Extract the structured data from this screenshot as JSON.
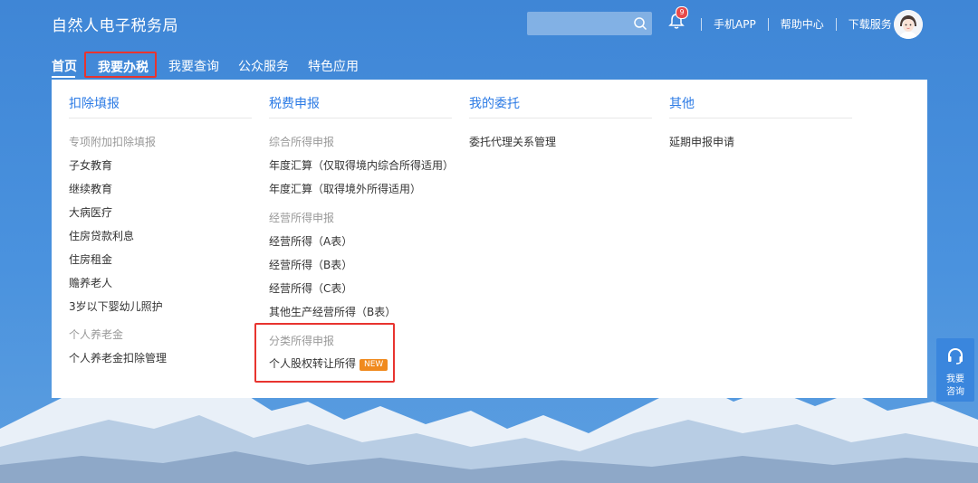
{
  "header": {
    "site_title": "自然人电子税务局",
    "search_placeholder": "",
    "notification_count": "9",
    "links": [
      "手机APP",
      "帮助中心",
      "下载服务"
    ]
  },
  "nav": {
    "home": "首页",
    "tax": "我要办税",
    "query": "我要查询",
    "public": "公众服务",
    "special": "特色应用"
  },
  "menu": {
    "col1": {
      "title": "扣除填报",
      "sub1": "专项附加扣除填报",
      "items1": [
        "子女教育",
        "继续教育",
        "大病医疗",
        "住房贷款利息",
        "住房租金",
        "赡养老人",
        "3岁以下婴幼儿照护"
      ],
      "sub2": "个人养老金",
      "items2": [
        "个人养老金扣除管理"
      ]
    },
    "col2": {
      "title": "税费申报",
      "sub1": "综合所得申报",
      "items1": [
        "年度汇算（仅取得境内综合所得适用）",
        "年度汇算（取得境外所得适用）"
      ],
      "sub2": "经营所得申报",
      "items2": [
        "经营所得（A表）",
        "经营所得（B表）",
        "经营所得（C表）",
        "其他生产经营所得（B表）"
      ],
      "sub3": "分类所得申报",
      "items3": [
        "个人股权转让所得"
      ],
      "new_label": "NEW"
    },
    "col3": {
      "title": "我的委托",
      "items": [
        "委托代理关系管理"
      ]
    },
    "col4": {
      "title": "其他",
      "items": [
        "延期申报申请"
      ]
    }
  },
  "consult": {
    "line1": "我要",
    "line2": "咨询"
  }
}
